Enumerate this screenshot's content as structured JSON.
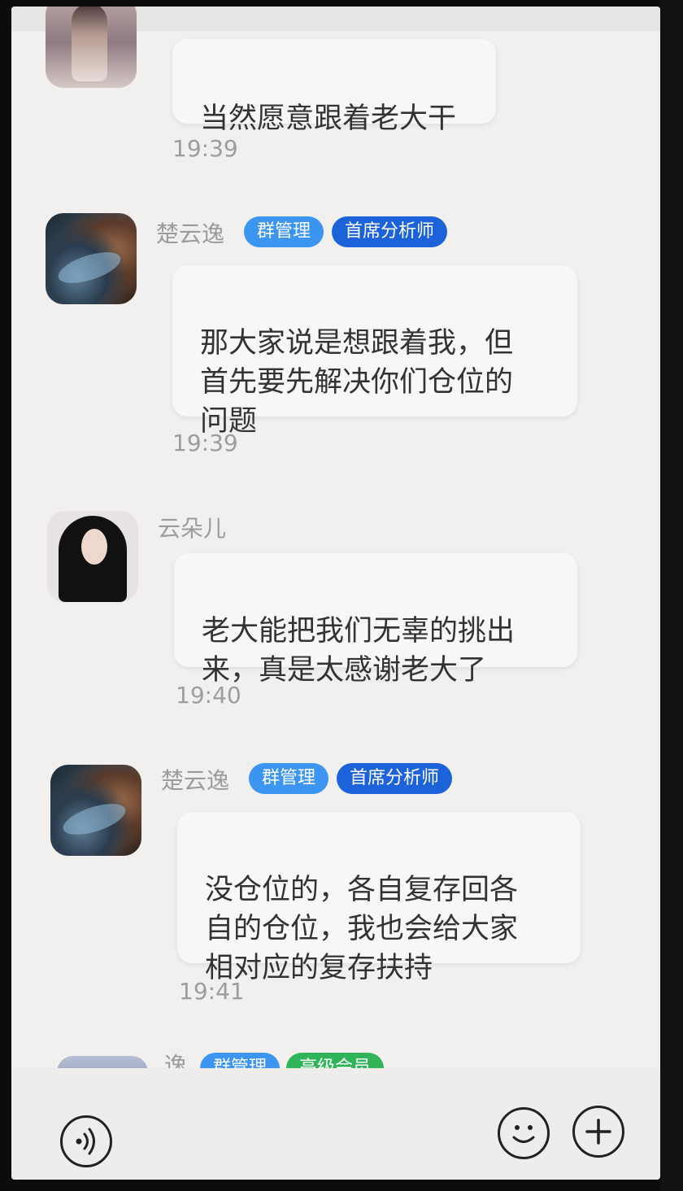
{
  "messages": [
    {
      "sender": "",
      "text": "当然愿意跟着老大干",
      "time": "19:39",
      "badges": []
    },
    {
      "sender": "楚云逸",
      "text": "那大家说是想跟着我，但\n首先要先解决你们仓位的\n问题",
      "time": "19:39",
      "badges": [
        "群管理",
        "首席分析师"
      ]
    },
    {
      "sender": "云朵儿",
      "text": "老大能把我们无辜的挑出\n来，真是太感谢老大了",
      "time": "19:40",
      "badges": []
    },
    {
      "sender": "楚云逸",
      "text": "没仓位的，各自复存回各\n自的仓位，我也会给大家\n相对应的复存扶持",
      "time": "19:41",
      "badges": [
        "群管理",
        "首席分析师"
      ]
    },
    {
      "sender": "逸",
      "text": "",
      "time": "",
      "badges": [
        "群管理",
        "高级会员"
      ]
    }
  ],
  "icons": {
    "voice": "voice-icon",
    "emoji": "emoji-icon",
    "plus": "plus-icon"
  },
  "colors": {
    "badge_admin": "#3c95f0",
    "badge_analyst": "#1c62d8",
    "badge_member": "#2fb45a",
    "background": "#f1f0ee"
  }
}
